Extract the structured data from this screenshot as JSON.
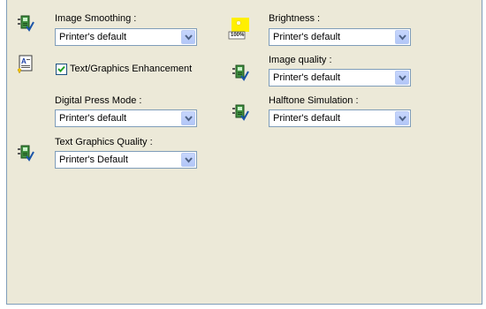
{
  "settings": {
    "image_smoothing": {
      "label": "Image Smoothing :",
      "value": "Printer's default"
    },
    "text_graphics_enhancement": {
      "label": "Text/Graphics Enhancement",
      "checked": true
    },
    "digital_press_mode": {
      "label": "Digital Press Mode :",
      "value": "Printer's default"
    },
    "text_graphics_quality": {
      "label": "Text Graphics Quality :",
      "value": "Printer's Default"
    },
    "brightness": {
      "label": "Brightness :",
      "value": "Printer's default",
      "icon_badge": "100%"
    },
    "image_quality": {
      "label": "Image quality :",
      "value": "Printer's default"
    },
    "halftone_simulation": {
      "label": "Halftone Simulation :",
      "value": "Printer's default"
    }
  },
  "icons": {
    "device_settings": "printer-settings-icon",
    "text_document": "text-document-icon",
    "brightness": "brightness-icon",
    "dropdown": "chevron-down-icon"
  },
  "colors": {
    "panel_background": "#ece9d8",
    "field_border": "#7f9db9",
    "dropdown_button": "#c7d6fc",
    "check_mark": "#21a121",
    "brightness_yellow": "#ffef00"
  }
}
